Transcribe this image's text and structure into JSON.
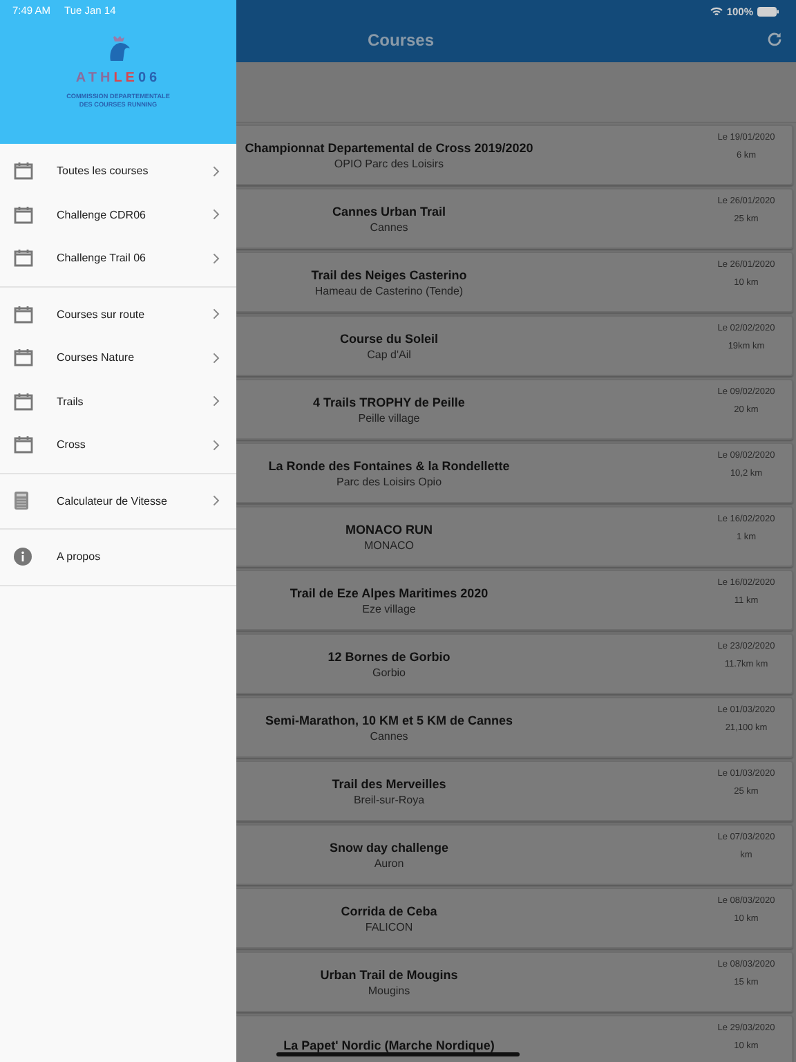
{
  "status_bar": {
    "time": "7:49 AM",
    "date": "Tue Jan 14",
    "battery": "100%"
  },
  "drawer": {
    "logo": {
      "parts": [
        {
          "text": "ATH",
          "color": "#8c6c9c"
        },
        {
          "text": "LE",
          "color": "#d8474e"
        },
        {
          "text": "06",
          "color": "#2a62b0"
        }
      ],
      "subtitle": [
        "COMMISSION DEPARTEMENTALE",
        "DES COURSES RUNNING"
      ]
    },
    "groups": [
      {
        "items": [
          {
            "kind": "calendar",
            "label": "Toutes les courses",
            "chevron": true
          },
          {
            "kind": "calendar",
            "label": "Challenge CDR06",
            "chevron": true
          },
          {
            "kind": "calendar",
            "label": "Challenge Trail 06",
            "chevron": true
          }
        ]
      },
      {
        "items": [
          {
            "kind": "calendar",
            "label": "Courses sur route",
            "chevron": true
          },
          {
            "kind": "calendar",
            "label": "Courses Nature",
            "chevron": true
          },
          {
            "kind": "calendar",
            "label": "Trails",
            "chevron": true
          },
          {
            "kind": "calendar",
            "label": "Cross",
            "chevron": true
          }
        ]
      },
      {
        "items": [
          {
            "kind": "calculator",
            "label": "Calculateur de Vitesse",
            "chevron": true
          }
        ]
      },
      {
        "items": [
          {
            "kind": "info",
            "label": "A propos",
            "chevron": false
          }
        ]
      }
    ]
  },
  "nav_bar": {
    "title": "Courses"
  },
  "races": [
    {
      "name": "Championnat Departemental de Cross 2019/2020",
      "place": "OPIO Parc des Loisirs",
      "date": "Le 19/01/2020",
      "distance": "6 km"
    },
    {
      "name": "Cannes Urban Trail",
      "place": "Cannes",
      "date": "Le 26/01/2020",
      "distance": "25 km"
    },
    {
      "name": "Trail des Neiges Casterino",
      "place": "Hameau de Casterino (Tende)",
      "date": "Le 26/01/2020",
      "distance": "10 km"
    },
    {
      "name": "Course du Soleil",
      "place": "Cap d'Ail",
      "date": "Le 02/02/2020",
      "distance": "19km km"
    },
    {
      "name": "4 Trails TROPHY de Peille",
      "place": "Peille village",
      "date": "Le 09/02/2020",
      "distance": "20 km"
    },
    {
      "name": "La Ronde des Fontaines & la Rondellette",
      "place": "Parc des Loisirs Opio",
      "date": "Le 09/02/2020",
      "distance": "10,2 km"
    },
    {
      "name": "MONACO RUN",
      "place": "MONACO",
      "date": "Le 16/02/2020",
      "distance": "1 km"
    },
    {
      "name": "Trail de Eze Alpes Maritimes 2020",
      "place": "Eze village",
      "date": "Le 16/02/2020",
      "distance": "11 km"
    },
    {
      "name": "12 Bornes de Gorbio",
      "place": "Gorbio",
      "date": "Le 23/02/2020",
      "distance": "11.7km km"
    },
    {
      "name": "Semi-Marathon, 10 KM et 5 KM de Cannes",
      "place": "Cannes",
      "date": "Le 01/03/2020",
      "distance": "21,100 km"
    },
    {
      "name": "Trail des Merveilles",
      "place": "Breil-sur-Roya",
      "date": "Le 01/03/2020",
      "distance": "25 km"
    },
    {
      "name": "Snow day challenge",
      "place": "Auron",
      "date": "Le 07/03/2020",
      "distance": "km"
    },
    {
      "name": "Corrida de Ceba",
      "place": "FALICON",
      "date": "Le 08/03/2020",
      "distance": "10 km"
    },
    {
      "name": "Urban Trail de Mougins",
      "place": "Mougins",
      "date": "Le 08/03/2020",
      "distance": "15 km"
    },
    {
      "name": "La Papet' Nordic (Marche Nordique)",
      "date": "Le 29/03/2020",
      "distance": "10 km"
    }
  ]
}
